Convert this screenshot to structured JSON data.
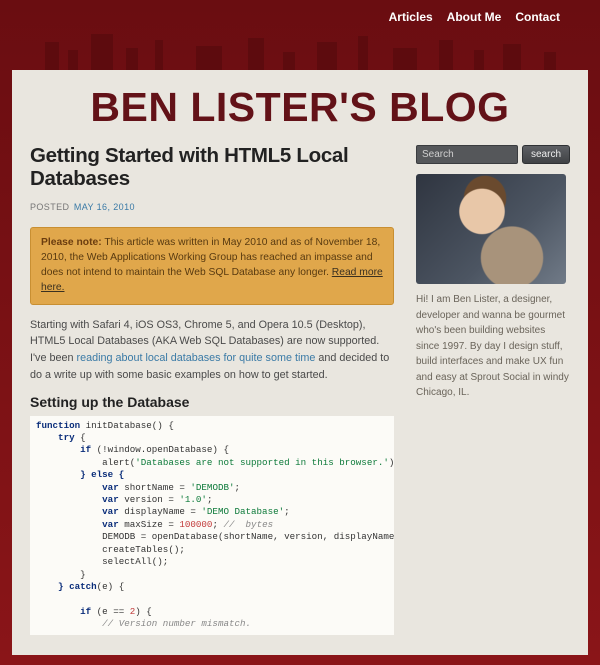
{
  "nav": {
    "items": [
      {
        "label": "Articles"
      },
      {
        "label": "About Me"
      },
      {
        "label": "Contact"
      }
    ]
  },
  "site": {
    "title": "BEN LISTER'S BLOG"
  },
  "article": {
    "title": "Getting Started with HTML5 Local Databases",
    "posted_label": "POSTED",
    "date": "MAY 16, 2010",
    "notice": {
      "prefix": "Please note:",
      "body": " This article was written in May 2010 and as of November 18, 2010, the Web Applications Working Group has reached an impasse and does not intend to maintain the Web SQL Database any longer. ",
      "link_text": "Read more here."
    },
    "intro": {
      "pre": "Starting with Safari 4, iOS OS3, Chrome 5, and Opera 10.5 (Desktop), HTML5 Local Databases (AKA Web SQL Databases) are now supported. I've been ",
      "link": "reading about local databases for quite some time",
      "post": " and decided to do a write up with some basic examples on how to get started."
    },
    "section_heading": "Setting up the Database"
  },
  "code": {
    "l1_kw": "function",
    "l1_fn": " initDatabase() {",
    "l2_kw": "    try",
    "l2_rest": " {",
    "l3_kw": "        if",
    "l3_rest": " (!window.openDatabase) {",
    "l4_pre": "            alert(",
    "l4_str": "'Databases are not supported in this browser.'",
    "l4_post": ");",
    "l5_kw": "        } else {",
    "l6_pre": "            var",
    "l6_var": " shortName = ",
    "l6_str": "'DEMODB'",
    "l6_end": ";",
    "l7_pre": "            var",
    "l7_var": " version = ",
    "l7_str": "'1.0'",
    "l7_end": ";",
    "l8_pre": "            var",
    "l8_var": " displayName = ",
    "l8_str": "'DEMO Database'",
    "l8_end": ";",
    "l9_pre": "            var",
    "l9_var": " maxSize = ",
    "l9_num": "100000",
    "l9_end": "; ",
    "l9_com": "//  bytes",
    "l10": "            DEMODB = openDatabase(shortName, version, displayName, maxSize",
    "l11": "            createTables();",
    "l12": "            selectAll();",
    "l13": "        }",
    "l14_kw": "    } catch",
    "l14_rest": "(e) {",
    "l15": "",
    "l16_kw": "        if",
    "l16_rest": " (e == ",
    "l16_num": "2",
    "l16_end": ") {",
    "l17_com": "            // Version number mismatch."
  },
  "sidebar": {
    "search": {
      "placeholder": "Search",
      "button": "search"
    },
    "bio": "Hi! I am Ben Lister, a designer, developer and wanna be gourmet who's been building websites since 1997. By day I design stuff, build interfaces and make UX fun and easy at Sprout Social in windy Chicago, IL."
  }
}
